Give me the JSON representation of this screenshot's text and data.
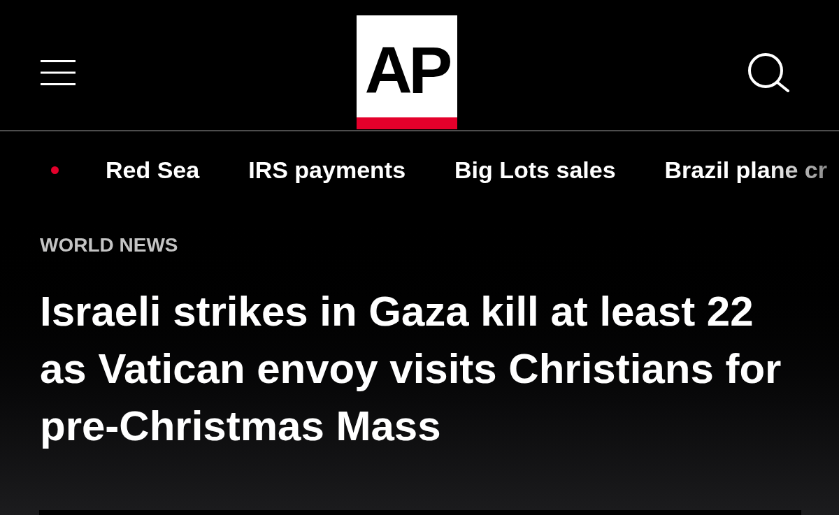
{
  "header": {
    "logo": {
      "text": "AP"
    }
  },
  "trending": {
    "items": [
      {
        "label": "Red Sea"
      },
      {
        "label": "IRS payments"
      },
      {
        "label": "Big Lots sales"
      },
      {
        "label": "Brazil plane cr"
      }
    ]
  },
  "article": {
    "section": "WORLD NEWS",
    "headline": "Israeli strikes in Gaza kill at least 22 as Vatican envoy visits Christians for pre-Christmas Mass"
  }
}
